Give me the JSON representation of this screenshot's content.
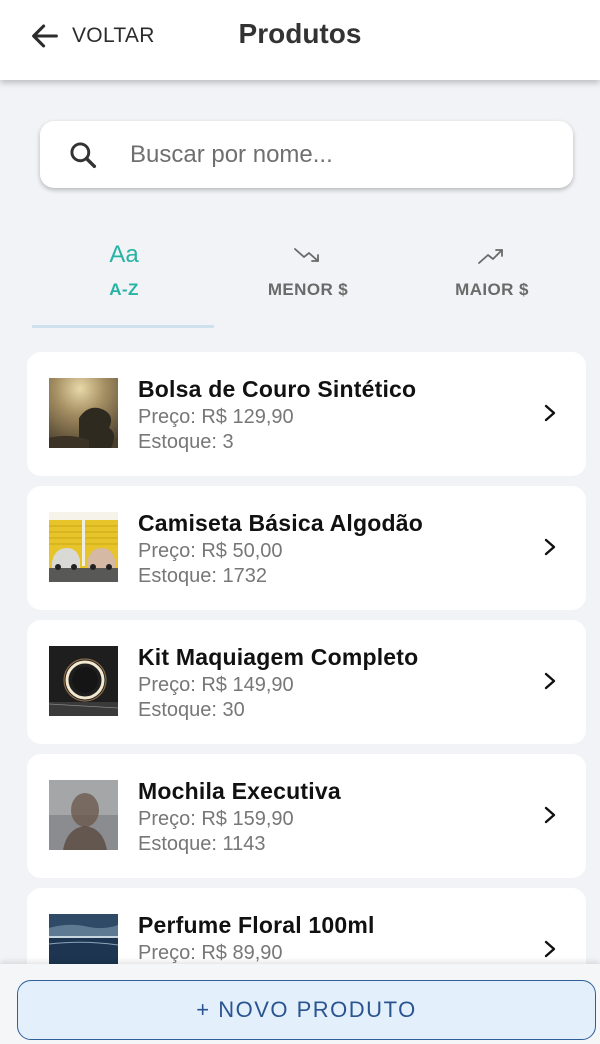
{
  "header": {
    "back_label": "VOLTAR",
    "title": "Produtos"
  },
  "search": {
    "placeholder": "Buscar por nome...",
    "value": ""
  },
  "sort_tabs": [
    {
      "icon": "text-sort-icon",
      "icon_text": "Aa",
      "label": "A-Z",
      "active": true
    },
    {
      "icon": "trending-down-icon",
      "label": "MENOR $",
      "active": false
    },
    {
      "icon": "trending-up-icon",
      "label": "MAIOR $",
      "active": false
    }
  ],
  "products": [
    {
      "name": "Bolsa de Couro Sintético",
      "price": "Preço: R$ 129,90",
      "stock": "Estoque: 3"
    },
    {
      "name": "Camiseta Básica Algodão",
      "price": "Preço: R$ 50,00",
      "stock": "Estoque: 1732"
    },
    {
      "name": "Kit Maquiagem Completo",
      "price": "Preço: R$ 149,90",
      "stock": "Estoque: 30"
    },
    {
      "name": "Mochila Executiva",
      "price": "Preço: R$ 159,90",
      "stock": "Estoque: 1143"
    },
    {
      "name": "Perfume Floral 100ml",
      "price": "Preço: R$ 89,90",
      "stock": ""
    }
  ],
  "footer": {
    "new_button_label": "+ NOVO PRODUTO"
  },
  "colors": {
    "accent": "#27b3a3",
    "primary": "#2a5490",
    "background": "#f1f3f6"
  }
}
